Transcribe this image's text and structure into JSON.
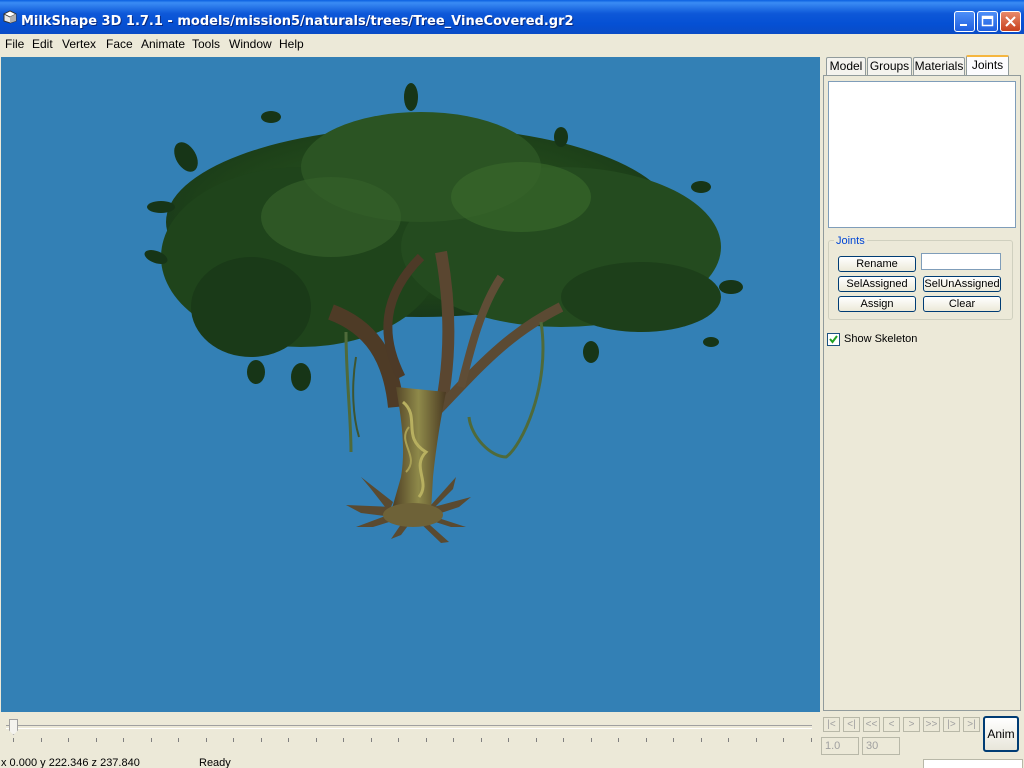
{
  "window": {
    "title": "MilkShape 3D 1.7.1 - models/mission5/naturals/trees/Tree_VineCovered.gr2"
  },
  "menu": [
    "File",
    "Edit",
    "Vertex",
    "Face",
    "Animate",
    "Tools",
    "Window",
    "Help"
  ],
  "tabs": [
    "Model",
    "Groups",
    "Materials",
    "Joints"
  ],
  "active_tab": "Joints",
  "joints_panel": {
    "group_label": "Joints",
    "rename_label": "Rename",
    "name_value": "",
    "sel_assigned_label": "SelAssigned",
    "sel_unassigned_label": "SelUnAssigned",
    "assign_label": "Assign",
    "clear_label": "Clear",
    "show_skeleton_label": "Show Skeleton",
    "show_skeleton_checked": true
  },
  "playback": {
    "buttons": [
      "|<",
      "<|",
      "<<",
      "<",
      ">",
      ">>",
      "|>",
      ">|"
    ],
    "start_frame": "1.0",
    "end_frame": "30",
    "anim_label": "Anim"
  },
  "status": {
    "coords": "x 0.000 y 222.346 z 237.840",
    "text": "Ready"
  },
  "colors": {
    "viewport_bg": "#3380b5",
    "titlebar": "#0a55d8",
    "panel_bg": "#ece9d8"
  }
}
